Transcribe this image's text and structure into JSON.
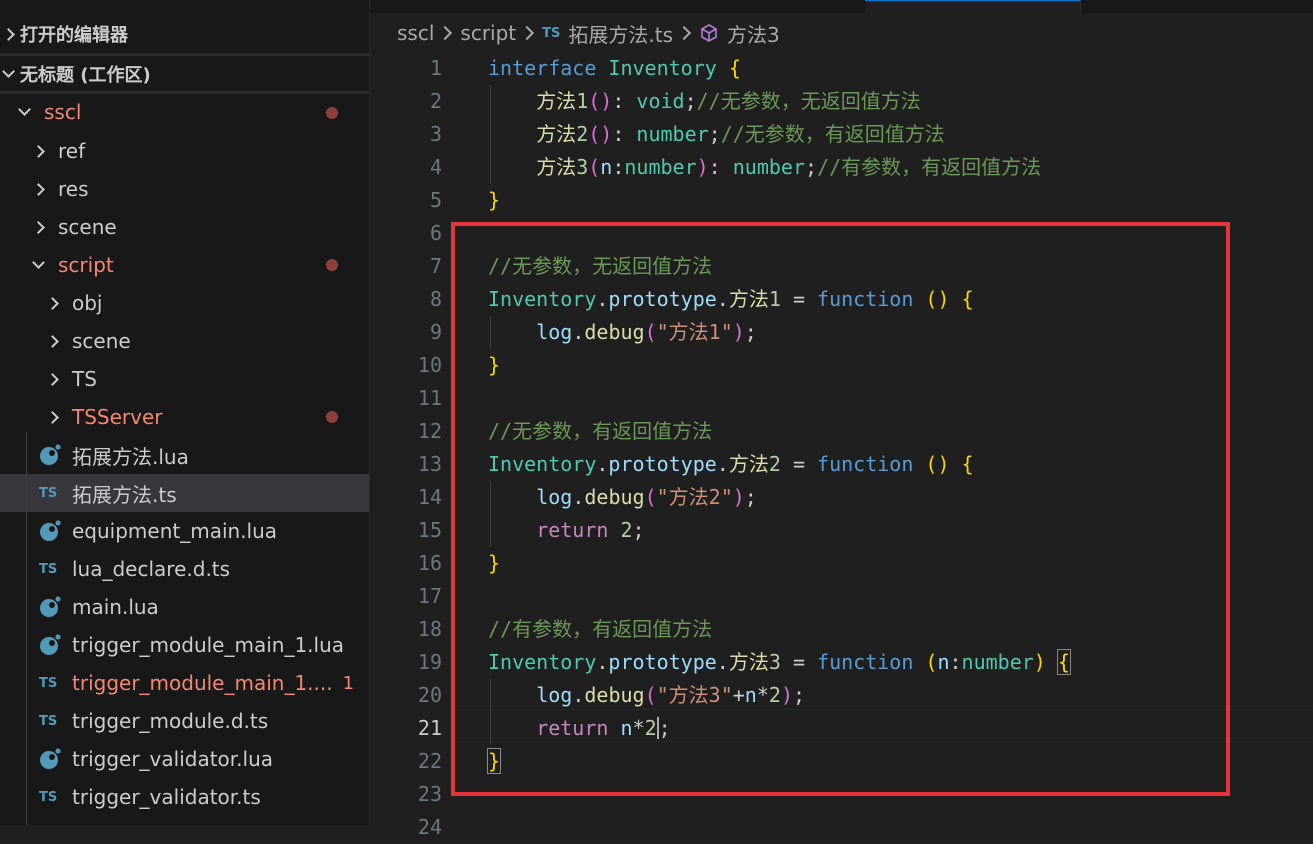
{
  "colors": {
    "highlight": "#e5343a",
    "modified": "#f48771",
    "ts_icon": "#519aba"
  },
  "sidebar": {
    "open_editors": "打开的编辑器",
    "workspace": "无标题 (工作区)",
    "root": "sscl",
    "items": [
      {
        "label": "ref",
        "kind": "folder"
      },
      {
        "label": "res",
        "kind": "folder"
      },
      {
        "label": "scene",
        "kind": "folder"
      },
      {
        "label": "script",
        "kind": "folder-open"
      },
      {
        "label": "obj",
        "kind": "folder"
      },
      {
        "label": "scene",
        "kind": "folder"
      },
      {
        "label": "TS",
        "kind": "folder"
      },
      {
        "label": "TSServer",
        "kind": "folder"
      },
      {
        "label": "拓展方法.lua",
        "icon": "lua"
      },
      {
        "label": "拓展方法.ts",
        "icon": "ts"
      },
      {
        "label": "equipment_main.lua",
        "icon": "lua"
      },
      {
        "label": "lua_declare.d.ts",
        "icon": "ts"
      },
      {
        "label": "main.lua",
        "icon": "lua"
      },
      {
        "label": "trigger_module_main_1.lua",
        "icon": "lua"
      },
      {
        "label": "trigger_module_main_1....",
        "icon": "ts",
        "problems": "1"
      },
      {
        "label": "trigger_module.d.ts",
        "icon": "ts"
      },
      {
        "label": "trigger_validator.lua",
        "icon": "lua"
      },
      {
        "label": "trigger_validator.ts",
        "icon": "ts"
      }
    ]
  },
  "breadcrumb": {
    "parts": [
      "sscl",
      "script",
      "拓展方法.ts",
      "方法3"
    ],
    "file_icon": "TS"
  },
  "editor": {
    "active_line": "21",
    "line_numbers": [
      "1",
      "2",
      "3",
      "4",
      "5",
      "6",
      "7",
      "8",
      "9",
      "10",
      "11",
      "12",
      "13",
      "14",
      "15",
      "16",
      "17",
      "18",
      "19",
      "20",
      "21",
      "22",
      "23",
      "24"
    ],
    "code_lines": [
      "interface Inventory {",
      "    方法1(): void;//无参数，无返回值方法",
      "    方法2(): number;//无参数，有返回值方法",
      "    方法3(n:number): number;//有参数，有返回值方法",
      "}",
      "",
      "//无参数，无返回值方法",
      "Inventory.prototype.方法1 = function () {",
      "    log.debug(\"方法1\");",
      "}",
      "",
      "//无参数，有返回值方法",
      "Inventory.prototype.方法2 = function () {",
      "    log.debug(\"方法2\");",
      "    return 2;",
      "}",
      "",
      "//有参数，有返回值方法",
      "Inventory.prototype.方法3 = function (n:number) {",
      "    log.debug(\"方法3\"+n*2);",
      "    return n*2;",
      "}",
      "",
      ""
    ]
  }
}
